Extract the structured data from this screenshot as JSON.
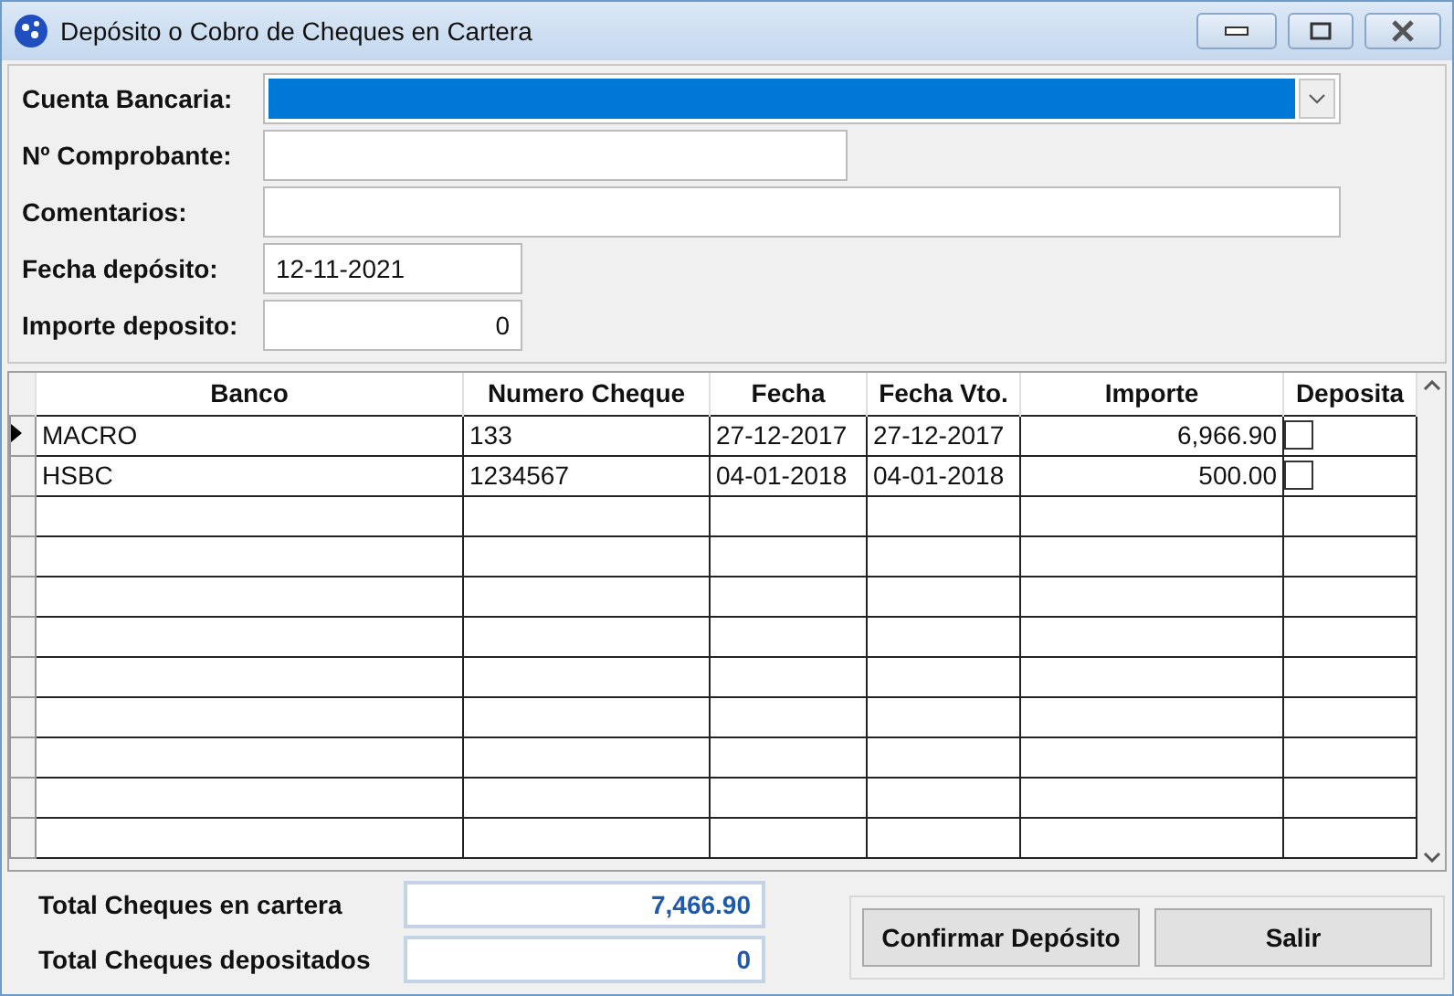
{
  "window": {
    "title": "Depósito o Cobro de Cheques en Cartera"
  },
  "form": [
    {
      "kind": "dropdown",
      "label": "Cuenta Bancaria:",
      "focused": true
    },
    {
      "kind": "text",
      "label": "Nº Comprobante:"
    },
    {
      "kind": "text",
      "label": "Comentarios:"
    },
    {
      "kind": "text",
      "label": "Fecha depósito:",
      "value": "12-11-2021"
    },
    {
      "kind": "number",
      "label": "Importe deposito:",
      "value": "0"
    }
  ],
  "table": {
    "columns": [
      "Banco",
      "Numero Cheque",
      "Fecha",
      "Fecha Vto.",
      "Importe",
      "Deposita"
    ],
    "rows": [
      {
        "selected": true,
        "cells": [
          "MACRO",
          "133",
          "27-12-2017",
          "27-12-2017",
          "6,966.90"
        ],
        "checked": false
      },
      {
        "selected": false,
        "cells": [
          "HSBC",
          "1234567",
          "04-01-2018",
          "04-01-2018",
          "500.00"
        ],
        "checked": false
      }
    ]
  },
  "totals": [
    {
      "label": "Total Cheques en cartera",
      "value": "7,466.90"
    },
    {
      "label": "Total Cheques depositados",
      "value": "0"
    }
  ],
  "buttons": [
    "Confirmar Depósito",
    "Salir"
  ]
}
